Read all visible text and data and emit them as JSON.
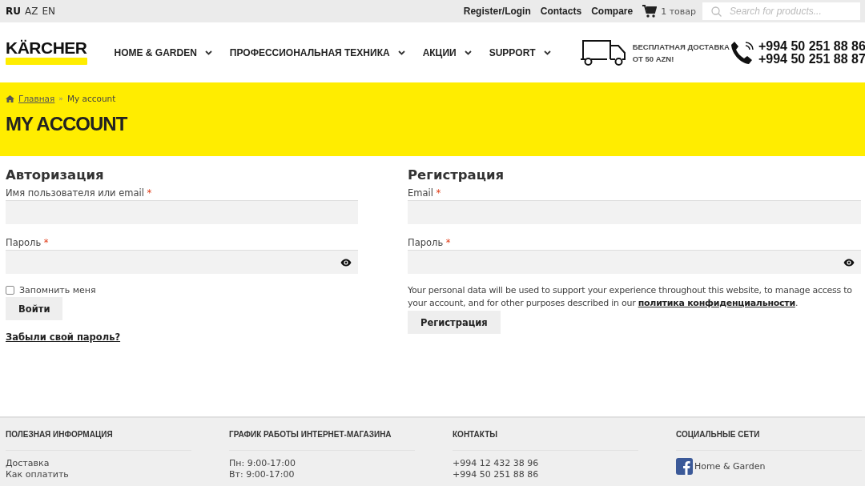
{
  "languages": [
    {
      "label": "RU",
      "selected": true
    },
    {
      "label": "AZ",
      "selected": false
    },
    {
      "label": "EN",
      "selected": false
    }
  ],
  "top_links": [
    "Register/Login",
    "Contacts",
    "Compare"
  ],
  "cart": {
    "label": "1 товар"
  },
  "search": {
    "placeholder": "Search for products..."
  },
  "logo": {
    "text": "KÄRCHER"
  },
  "nav": [
    {
      "label": "HOME & GARDEN"
    },
    {
      "label": "ПРОФЕССИОНАЛЬНАЯ ТЕХНИКА"
    },
    {
      "label": "АКЦИИ"
    },
    {
      "label": "SUPPORT"
    }
  ],
  "delivery": {
    "line_1": "БЕСПЛАТНАЯ ДОСТАВКА",
    "line_2": "ОТ 50 AZN!"
  },
  "phones": [
    "+994 50 251 88 86",
    "+994 50 251 88 87"
  ],
  "breadcrumb": {
    "home": "Главная",
    "separator": "»",
    "current": "My account"
  },
  "page_title": "MY ACCOUNT",
  "login": {
    "title": "Авторизация",
    "fields": [
      {
        "label": "Имя пользователя или email",
        "required_mark": "*",
        "kind": "text"
      },
      {
        "label": "Пароль",
        "required_mark": "*",
        "kind": "password"
      }
    ],
    "remember": {
      "label": "Запомнить меня",
      "checked": false
    },
    "button": "Войти",
    "lost_password": "Забыли свой пароль?"
  },
  "register": {
    "title": "Регистрация",
    "fields": [
      {
        "label": "Email",
        "required_mark": "*",
        "kind": "text"
      },
      {
        "label": "Пароль",
        "required_mark": "*",
        "kind": "password"
      }
    ],
    "privacy_text": "Your personal data will be used to support your experience throughout this website, to manage access to your account, and for other purposes described in our",
    "privacy_link": "политика конфиденциальности",
    "privacy_end": ".",
    "button": "Регистрация"
  },
  "footer": [
    {
      "title": "ПОЛЕЗНАЯ ИНФОРМАЦИЯ",
      "kind": "links",
      "items": [
        "Доставка",
        "Как оплатить"
      ]
    },
    {
      "title": "ГРАФИК РАБОТЫ ИНТЕРНЕТ-МАГАЗИНА",
      "kind": "text",
      "items": [
        "Пн: 9:00-17:00",
        "Вт: 9:00-17:00"
      ]
    },
    {
      "title": "КОНТАКТЫ",
      "kind": "text",
      "items": [
        "+994 12 432 38 96",
        "+994 50 251 88 86"
      ]
    },
    {
      "title": "СОЦИАЛЬНЫЕ СЕТИ",
      "kind": "social",
      "items": [
        "Home & Garden"
      ]
    }
  ]
}
